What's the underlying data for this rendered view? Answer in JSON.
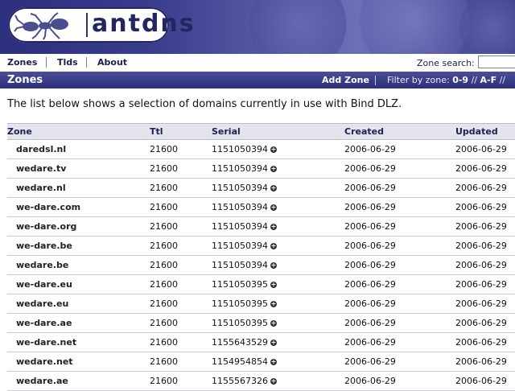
{
  "app": {
    "logo_text": "antdns"
  },
  "nav": {
    "items": [
      {
        "label": "Zones"
      },
      {
        "label": "Tlds"
      },
      {
        "label": "About"
      }
    ],
    "search_label": "Zone search:",
    "search_value": ""
  },
  "titlebar": {
    "title": "Zones",
    "add_zone": "Add Zone",
    "filter_label": "Filter by zone:",
    "filter_options": [
      "0-9",
      "A-F"
    ],
    "filter_separator": "//"
  },
  "intro_text": "The list below shows a selection of domains currently in use with Bind DLZ.",
  "table": {
    "headers": [
      "Zone",
      "Ttl",
      "Serial",
      "Created",
      "Updated"
    ],
    "rows": [
      {
        "zone": "daredsl.nl",
        "ttl": "21600",
        "serial": "1151050394",
        "created": "2006-06-29",
        "updated": "2006-06-29"
      },
      {
        "zone": "wedare.tv",
        "ttl": "21600",
        "serial": "1151050394",
        "created": "2006-06-29",
        "updated": "2006-06-29"
      },
      {
        "zone": "wedare.nl",
        "ttl": "21600",
        "serial": "1151050394",
        "created": "2006-06-29",
        "updated": "2006-06-29"
      },
      {
        "zone": "we-dare.com",
        "ttl": "21600",
        "serial": "1151050394",
        "created": "2006-06-29",
        "updated": "2006-06-29"
      },
      {
        "zone": "we-dare.org",
        "ttl": "21600",
        "serial": "1151050394",
        "created": "2006-06-29",
        "updated": "2006-06-29"
      },
      {
        "zone": "we-dare.be",
        "ttl": "21600",
        "serial": "1151050394",
        "created": "2006-06-29",
        "updated": "2006-06-29"
      },
      {
        "zone": "wedare.be",
        "ttl": "21600",
        "serial": "1151050394",
        "created": "2006-06-29",
        "updated": "2006-06-29"
      },
      {
        "zone": "we-dare.eu",
        "ttl": "21600",
        "serial": "1151050395",
        "created": "2006-06-29",
        "updated": "2006-06-29"
      },
      {
        "zone": "wedare.eu",
        "ttl": "21600",
        "serial": "1151050395",
        "created": "2006-06-29",
        "updated": "2006-06-29"
      },
      {
        "zone": "we-dare.ae",
        "ttl": "21600",
        "serial": "1151050395",
        "created": "2006-06-29",
        "updated": "2006-06-29"
      },
      {
        "zone": "we-dare.net",
        "ttl": "21600",
        "serial": "1155643529",
        "created": "2006-06-29",
        "updated": "2006-06-29"
      },
      {
        "zone": "wedare.net",
        "ttl": "21600",
        "serial": "1154954854",
        "created": "2006-06-29",
        "updated": "2006-06-29"
      },
      {
        "zone": "wedare.ae",
        "ttl": "21600",
        "serial": "1155567326",
        "created": "2006-06-29",
        "updated": "2006-06-29"
      }
    ]
  },
  "icons": {
    "serial_expand": "plus-circle-icon",
    "logo": "ant-icon"
  },
  "colors": {
    "brand": "#2c2f7e",
    "title_bar": "#3a3d8e",
    "header_bg": "#e4e4ee"
  }
}
